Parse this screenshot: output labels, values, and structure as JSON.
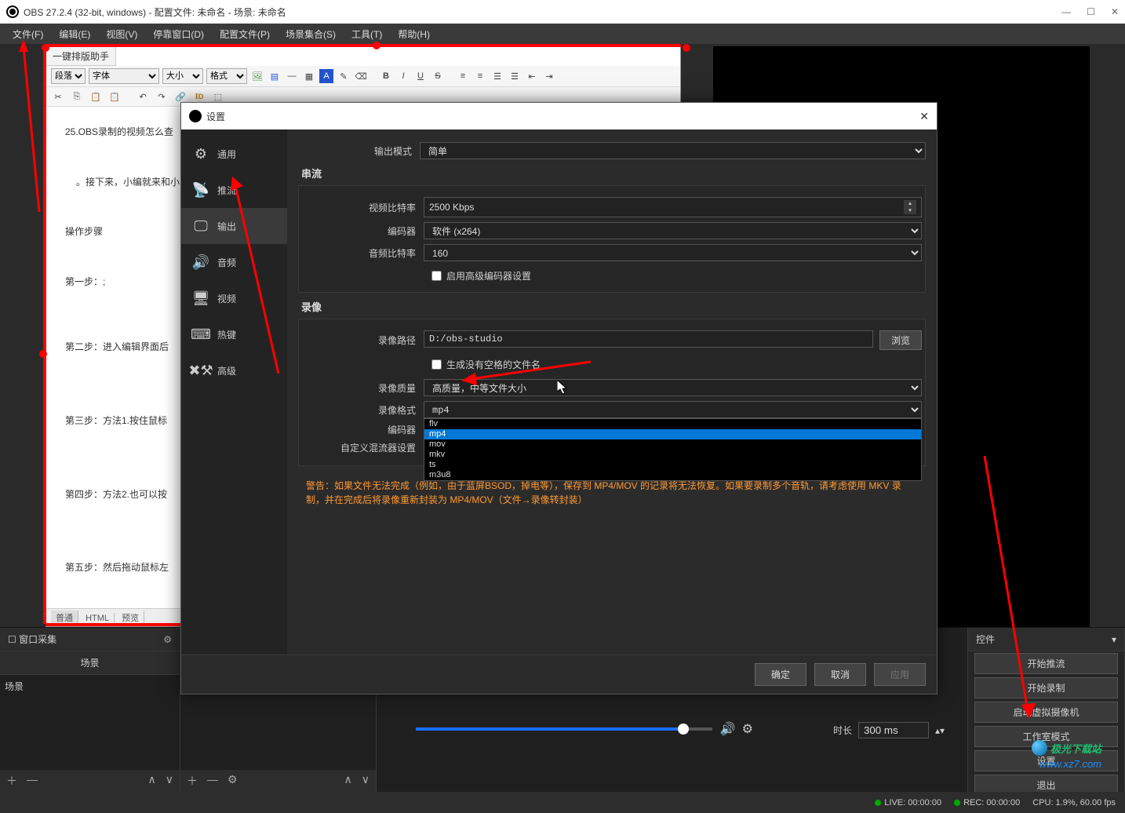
{
  "titlebar": {
    "title": "OBS 27.2.4 (32-bit, windows) - 配置文件: 未命名 - 场景: 未命名"
  },
  "menubar": {
    "items": [
      "文件(F)",
      "编辑(E)",
      "视图(V)",
      "停靠窗口(D)",
      "配置文件(P)",
      "场景集合(S)",
      "工具(T)",
      "帮助(H)"
    ]
  },
  "editor": {
    "tab": "一键排版助手",
    "dropdowns": {
      "style": "段落",
      "font": "字体",
      "size": "大小",
      "format": "格式"
    },
    "lines": {
      "l0": "25.OBS录制的视频怎么查",
      "l1": "。接下来，小编就来和小",
      "l2": "操作步骤",
      "l3": "第一步：;",
      "l4": "第二步：进入编辑界面后",
      "l5": "第三步：方法1.按住鼠标",
      "l6": "第四步：方法2.也可以按",
      "l7": "第五步：然后拖动鼠标左"
    },
    "footerTabs": [
      "普通",
      "HTML",
      "预览"
    ]
  },
  "scenes_panel": {
    "title": "场景",
    "item": "场景"
  },
  "sources_panel": {
    "title": "窗口采集"
  },
  "controls": {
    "title": "控件",
    "buttons": [
      "开始推流",
      "开始录制",
      "启动虚拟摄像机",
      "工作室模式",
      "设置",
      "退出"
    ]
  },
  "settings": {
    "title": "设置",
    "sidebar": [
      "通用",
      "推流",
      "输出",
      "音频",
      "视频",
      "热键",
      "高级"
    ],
    "outputMode": {
      "label": "输出模式",
      "value": "简单"
    },
    "streaming": {
      "title": "串流",
      "videoBitrate": {
        "label": "视频比特率",
        "value": "2500 Kbps"
      },
      "encoder": {
        "label": "编码器",
        "value": "软件 (x264)"
      },
      "audioBitrate": {
        "label": "音频比特率",
        "value": "160"
      },
      "advanced": {
        "label": "启用高级编码器设置"
      }
    },
    "recording": {
      "title": "录像",
      "path": {
        "label": "录像路径",
        "value": "D:/obs-studio",
        "browse": "浏览"
      },
      "noSpace": {
        "label": "生成没有空格的文件名"
      },
      "quality": {
        "label": "录像质量",
        "value": "高质量，中等文件大小"
      },
      "format": {
        "label": "录像格式",
        "value": "mp4",
        "options": [
          "flv",
          "mp4",
          "mov",
          "mkv",
          "ts",
          "m3u8"
        ]
      },
      "encoder2": {
        "label": "编码器"
      },
      "muxer": {
        "label": "自定义混流器设置"
      }
    },
    "warning": "警告：如果文件无法完成（例如，由于蓝屏BSOD，掉电等），保存到 MP4/MOV 的记录将无法恢复。如果要录制多个音轨，请考虑使用 MKV 录制，并在完成后将录像重新封装为 MP4/MOV（文件→录像转封装）",
    "buttons": {
      "ok": "确定",
      "cancel": "取消",
      "apply": "应用"
    }
  },
  "transition": {
    "durationLabel": "时长",
    "durationValue": "300 ms"
  },
  "statusbar": {
    "live": "LIVE: 00:00:00",
    "rec": "REC: 00:00:00",
    "cpu": "CPU: 1.9%, 60.00 fps"
  },
  "watermark": {
    "text": "www.xz7.com",
    "brand": "极光下载站"
  }
}
